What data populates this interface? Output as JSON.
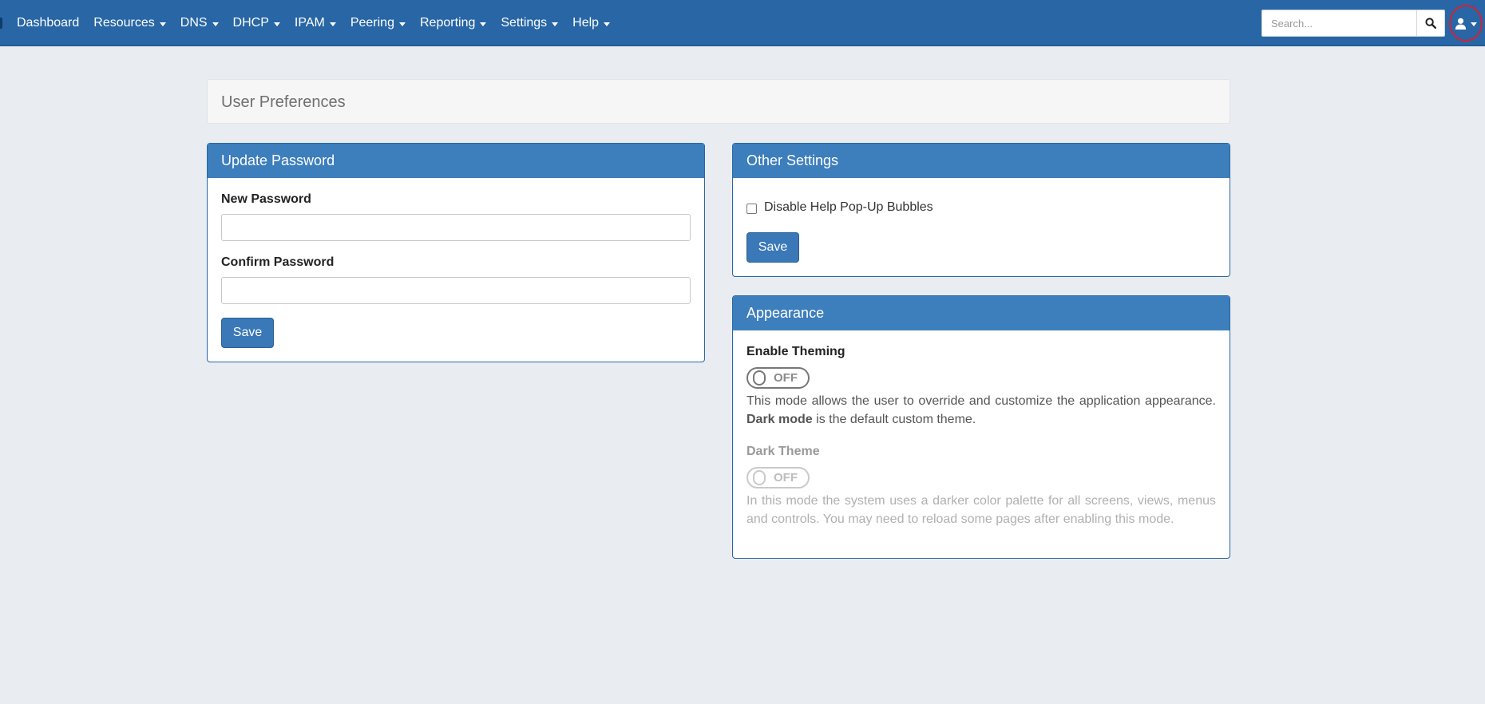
{
  "navbar": {
    "items": [
      {
        "label": "Dashboard",
        "dropdown": false
      },
      {
        "label": "Resources",
        "dropdown": true
      },
      {
        "label": "DNS",
        "dropdown": true
      },
      {
        "label": "DHCP",
        "dropdown": true
      },
      {
        "label": "IPAM",
        "dropdown": true
      },
      {
        "label": "Peering",
        "dropdown": true
      },
      {
        "label": "Reporting",
        "dropdown": true
      },
      {
        "label": "Settings",
        "dropdown": true
      },
      {
        "label": "Help",
        "dropdown": true
      }
    ],
    "search": {
      "placeholder": "Search...",
      "value": ""
    },
    "search_icon": "search-icon",
    "user_icon": "user-icon",
    "color": "#2866a5"
  },
  "page": {
    "title": "User Preferences"
  },
  "update_password": {
    "title": "Update Password",
    "new_password_label": "New Password",
    "new_password_value": "",
    "confirm_password_label": "Confirm Password",
    "confirm_password_value": "",
    "save_label": "Save"
  },
  "other_settings": {
    "title": "Other Settings",
    "disable_help_label": "Disable Help Pop-Up Bubbles",
    "disable_help_checked": false,
    "save_label": "Save"
  },
  "appearance": {
    "title": "Appearance",
    "enable_theming_label": "Enable Theming",
    "enable_theming_state": "OFF",
    "enable_theming_desc_prefix": "This mode allows the user to override and customize the application appearance. ",
    "enable_theming_desc_bold": "Dark mode",
    "enable_theming_desc_suffix": " is the default custom theme.",
    "dark_theme_label": "Dark Theme",
    "dark_theme_state": "OFF",
    "dark_theme_desc": "In this mode the system uses a darker color palette for all screens, views, menus and controls. You may need to reload some pages after enabling this mode."
  },
  "colors": {
    "panel_heading": "#3d7ebd",
    "button": "#3a78b8",
    "page_bg": "#e9edf1"
  }
}
